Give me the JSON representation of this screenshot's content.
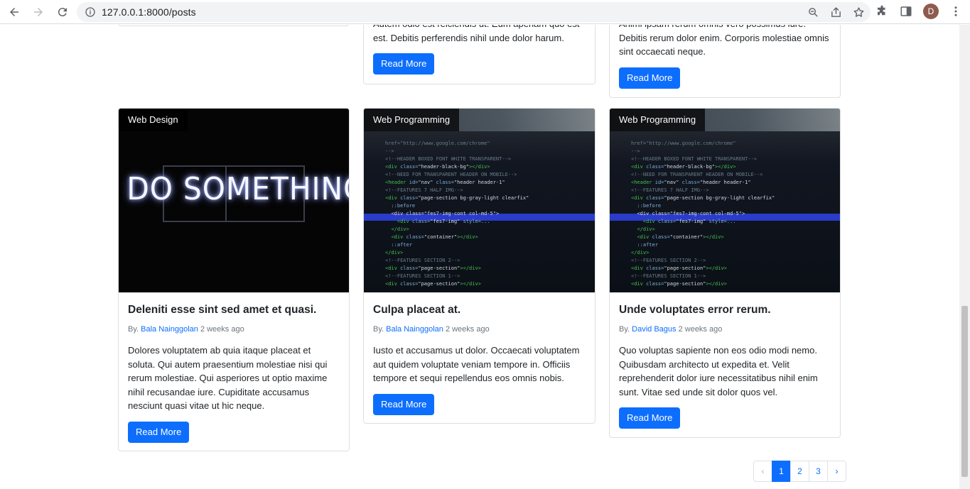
{
  "browser": {
    "url": "127.0.0.1:8000/posts",
    "avatar_initial": "D"
  },
  "top_cards": [
    {
      "desc_line1": "Autem odio est reiciendis ut. Eum aperiam quo est",
      "desc_line2": "est. Debitis perferendis nihil unde dolor harum.",
      "button": "Read More"
    },
    {
      "desc_line1": "Animi ipsam rerum omnis vero possimus iure.",
      "desc_line2": "Debitis rerum dolor enim. Corporis molestiae omnis sint occaecati neque.",
      "button": "Read More"
    }
  ],
  "posts": [
    {
      "category": "Web Design",
      "image_text": "DO SOMETHING GREAT",
      "title": "Deleniti esse sint sed amet et quasi.",
      "by": "By.",
      "author": "Bala Nainggolan",
      "time": "2 weeks ago",
      "excerpt": "Dolores voluptatem ab quia itaque placeat et soluta. Qui autem praesentium molestiae nisi qui rerum molestiae. Qui asperiores ut optio maxime nihil recusandae iure. Cupiditate accusamus nesciunt quasi vitae ut hic neque.",
      "button": "Read More"
    },
    {
      "category": "Web Programming",
      "title": "Culpa placeat at.",
      "by": "By.",
      "author": "Bala Nainggolan",
      "time": "2 weeks ago",
      "excerpt": "Iusto et accusamus ut dolor. Occaecati voluptatem aut quidem voluptate veniam tempore in. Officiis tempore et sequi repellendus eos omnis nobis.",
      "button": "Read More"
    },
    {
      "category": "Web Programming",
      "title": "Unde voluptates error rerum.",
      "by": "By.",
      "author": "David Bagus",
      "time": "2 weeks ago",
      "excerpt": "Quo voluptas sapiente non eos odio modi nemo. Quibusdam architecto ut expedita et. Velit reprehenderit dolor iure necessitatibus nihil enim sunt. Vitae sed unde sit dolor quos vel.",
      "button": "Read More"
    }
  ],
  "pagination": {
    "prev": "‹",
    "pages": [
      "1",
      "2",
      "3"
    ],
    "next": "›",
    "active": "1"
  },
  "colors": {
    "primary": "#0d6efd",
    "card_border": "#dfdfdf"
  }
}
